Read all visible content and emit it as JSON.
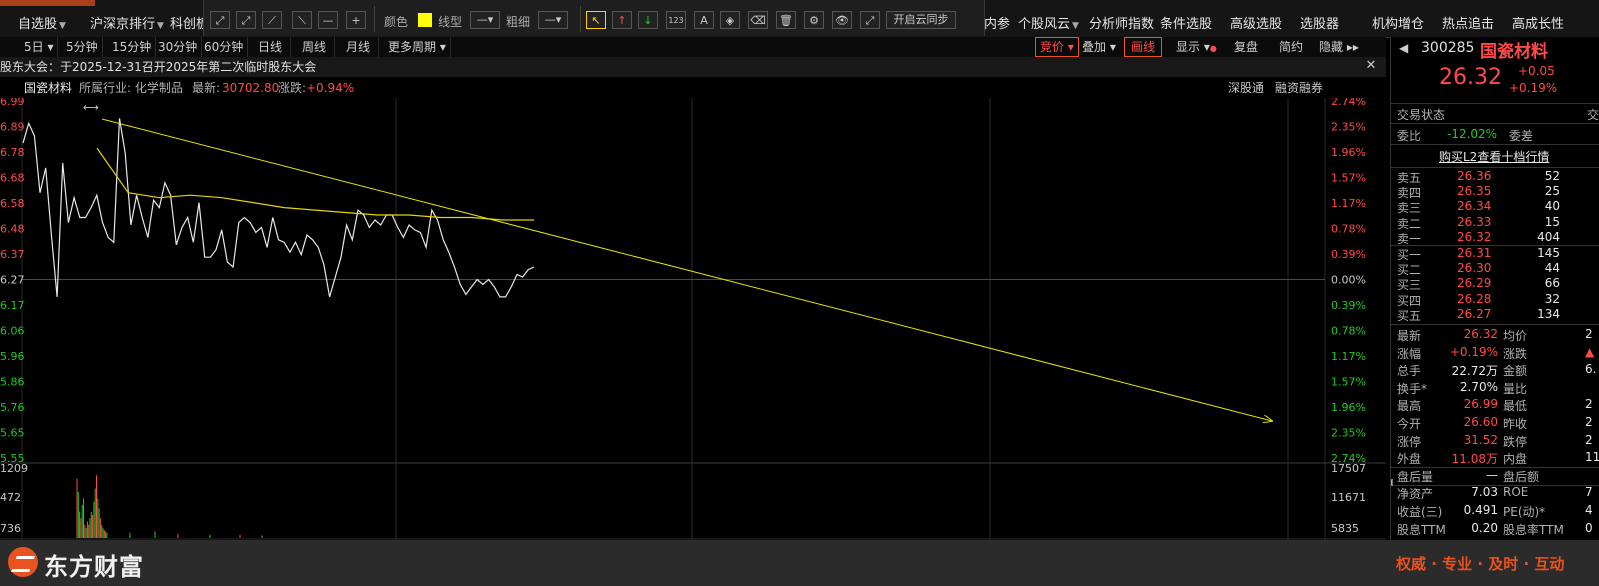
{
  "top_menu": {
    "left_items": [
      "自选股",
      "沪深京排行",
      "科创板"
    ],
    "right_items": [
      "内参",
      "个股风云",
      "分析师指数",
      "条件选股",
      "高级选股",
      "选股器",
      "机构增仓",
      "热点追击",
      "高成长性"
    ]
  },
  "drawing_toolbar": {
    "line_tools": [
      "⤢",
      "⤢",
      "⟋",
      "⟍",
      "—",
      "+"
    ],
    "color_label": "颜色",
    "line_type_label": "线型",
    "line_type_value": "—",
    "thickness_label": "粗细",
    "thickness_value": "—",
    "tools": [
      "↖",
      "↑",
      "↓",
      "123",
      "A",
      "◈",
      "⌫",
      "🗑",
      "⚙",
      "👁",
      "⤢"
    ],
    "sync_label": "开启云同步"
  },
  "period_bar": {
    "tabs": [
      "5日",
      "5分钟",
      "15分钟",
      "30分钟",
      "60分钟",
      "日线",
      "周线",
      "月线",
      "更多周期"
    ],
    "right_buttons": [
      "竞价",
      "叠加",
      "画线",
      "显示",
      "复盘",
      "简约",
      "隐藏"
    ]
  },
  "notice": "股东大会：于2025-12-31召开2025年第二次临时股东大会",
  "info_line": {
    "name": "国瓷材料",
    "industry": "所属行业: 化学制品",
    "latest_label": "最新:",
    "latest_value": "30702.80",
    "change_label": "涨跌:",
    "change_value": "+0.94%",
    "tag1": "深股通",
    "tag2": "融资融券"
  },
  "chart_data": {
    "type": "line",
    "title": "",
    "y_price_ticks": [
      "6.99",
      "6.89",
      "6.78",
      "6.68",
      "6.58",
      "6.48",
      "6.37",
      "6.27",
      "6.17",
      "6.06",
      "5.96",
      "5.86",
      "5.76",
      "5.65",
      "5.55"
    ],
    "y_pct_ticks": [
      "2.74%",
      "2.35%",
      "1.96%",
      "1.57%",
      "1.17%",
      "0.78%",
      "0.39%",
      "0.00%",
      "0.39%",
      "0.78%",
      "1.17%",
      "1.57%",
      "1.96%",
      "2.35%",
      "2.74%"
    ],
    "price_line": [
      26.82,
      26.9,
      26.85,
      26.62,
      26.72,
      26.45,
      26.2,
      26.74,
      26.5,
      26.6,
      26.52,
      26.52,
      26.56,
      26.61,
      26.5,
      26.44,
      26.42,
      26.92,
      26.78,
      26.49,
      26.61,
      26.52,
      26.44,
      26.59,
      26.56,
      26.66,
      26.61,
      26.41,
      26.48,
      26.52,
      26.42,
      26.58,
      26.36,
      26.36,
      26.39,
      26.47,
      26.34,
      26.32,
      26.5,
      26.52,
      26.5,
      26.46,
      26.48,
      26.4,
      26.52,
      26.43,
      26.42,
      26.38,
      26.42,
      26.37,
      26.45,
      26.43,
      26.4,
      26.33,
      26.2,
      26.28,
      26.36,
      26.49,
      26.43,
      26.55,
      26.53,
      26.48,
      26.51,
      26.49,
      26.53,
      26.53,
      26.48,
      26.44,
      26.49,
      26.47,
      26.46,
      26.4,
      26.55,
      26.51,
      26.43,
      26.38,
      26.32,
      26.25,
      26.21,
      26.24,
      26.27,
      26.25,
      26.27,
      26.24,
      26.2,
      26.2,
      26.24,
      26.29,
      26.28,
      26.31,
      26.32
    ],
    "avg_line": [
      26.8,
      26.62,
      26.6,
      26.61,
      26.6,
      26.58,
      26.56,
      26.55,
      26.54,
      26.53,
      26.53,
      26.52,
      26.52,
      26.51,
      26.51
    ],
    "trendline": [
      [
        0,
        26.88
      ],
      [
        1,
        25.6
      ]
    ],
    "volume_ticks_left": [
      "1209",
      "472",
      "736"
    ],
    "volume_ticks_right": [
      "17507",
      "11671",
      "5835"
    ]
  },
  "quote_panel": {
    "code": "300285",
    "name": "国瓷材料",
    "price": "26.32",
    "change": "+0.05",
    "change_pct": "+0.19%",
    "trade_status_label": "交易状态",
    "trade_status_value": "交",
    "weibi_label": "委比",
    "weibi_value": "-12.02%",
    "weicha_label": "委差",
    "l2_link": "购买L2查看十档行情",
    "asks": [
      {
        "label": "卖五",
        "price": "26.36",
        "vol": "52"
      },
      {
        "label": "卖四",
        "price": "26.35",
        "vol": "25"
      },
      {
        "label": "卖三",
        "price": "26.34",
        "vol": "40"
      },
      {
        "label": "卖二",
        "price": "26.33",
        "vol": "15"
      },
      {
        "label": "卖一",
        "price": "26.32",
        "vol": "404"
      }
    ],
    "bids": [
      {
        "label": "买一",
        "price": "26.31",
        "vol": "145"
      },
      {
        "label": "买二",
        "price": "26.30",
        "vol": "44"
      },
      {
        "label": "买三",
        "price": "26.29",
        "vol": "66"
      },
      {
        "label": "买四",
        "price": "26.28",
        "vol": "32"
      },
      {
        "label": "买五",
        "price": "26.27",
        "vol": "134"
      }
    ],
    "stats": [
      {
        "l1": "最新",
        "v1": "26.32",
        "c1": "red",
        "l2": "均价",
        "v2": "2"
      },
      {
        "l1": "涨幅",
        "v1": "+0.19%",
        "c1": "red",
        "l2": "涨跌",
        "v2": "▲"
      },
      {
        "l1": "总手",
        "v1": "22.72万",
        "c1": "white",
        "l2": "金额",
        "v2": "6."
      },
      {
        "l1": "换手*",
        "v1": "2.70%",
        "c1": "white",
        "l2": "量比",
        "v2": ""
      },
      {
        "l1": "最高",
        "v1": "26.99",
        "c1": "red",
        "l2": "最低",
        "v2": "2"
      },
      {
        "l1": "今开",
        "v1": "26.60",
        "c1": "red",
        "l2": "昨收",
        "v2": "2"
      },
      {
        "l1": "涨停",
        "v1": "31.52",
        "c1": "red",
        "l2": "跌停",
        "v2": "2"
      },
      {
        "l1": "外盘",
        "v1": "11.08万",
        "c1": "red",
        "l2": "内盘",
        "v2": "11."
      },
      {
        "l1": "盘后量",
        "v1": "—",
        "c1": "white",
        "l2": "盘后额",
        "v2": ""
      },
      {
        "l1": "净资产",
        "v1": "7.03",
        "c1": "white",
        "l2": "ROE",
        "v2": "7"
      },
      {
        "l1": "收益(三)",
        "v1": "0.491",
        "c1": "white",
        "l2": "PE(动)*",
        "v2": "4"
      },
      {
        "l1": "股息TTM",
        "v1": "0.20",
        "c1": "white",
        "l2": "股息率TTM",
        "v2": "0"
      }
    ]
  },
  "footer": {
    "logo_text": "东方财富",
    "slogan": "权威 · 专业 · 及时 · 互动"
  },
  "colors": {
    "accent_orange": "#e8531f",
    "up_red": "#ff4a4a",
    "down_green": "#22c922",
    "price_line": "#e8e8e8",
    "avg_line": "#e6d400",
    "trend_line": "#e6e600"
  }
}
